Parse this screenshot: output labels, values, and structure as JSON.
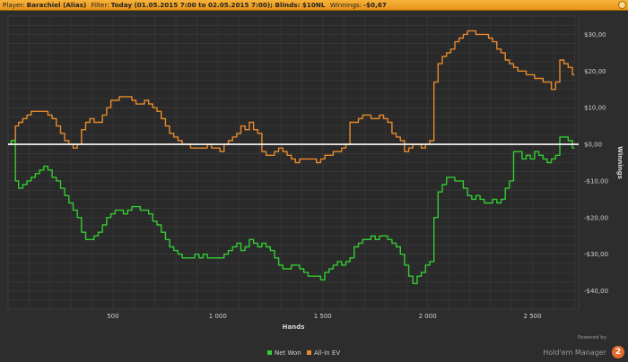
{
  "header": {
    "player_label": "Player:",
    "player_value": "Barachiel (Alias)",
    "filter_label": "Filter:",
    "filter_value": "Today (01.05.2015 7:00 to 02.05.2015 7:00); Blinds: $10NL",
    "winnings_label": "Winnings:",
    "winnings_value": "-$0,67"
  },
  "footer": {
    "powered_by": "Powered by",
    "product_name": "Hold'em Manager",
    "logo_text": "2"
  },
  "colors": {
    "background": "#2d2d2d",
    "plot_background": "#2a2a2a",
    "grid": "#3d3d3d",
    "net_won": "#33cc33",
    "all_in_ev": "#e88a2a",
    "zero_line": "#ffffff",
    "header": "#f0a52b"
  },
  "chart_data": {
    "type": "line",
    "xlabel": "Hands",
    "ylabel": "Winnings",
    "xlim": [
      0,
      2720
    ],
    "ylim": [
      -45,
      35
    ],
    "x_ticks": [
      500,
      1000,
      1500,
      2000,
      2500
    ],
    "x_tick_labels": [
      "500",
      "1 000",
      "1 500",
      "2 000",
      "2 500"
    ],
    "y_ticks": [
      30,
      20,
      10,
      0,
      -10,
      -20,
      -30,
      -40
    ],
    "y_tick_labels": [
      "$30,00",
      "$20,00",
      "$10,00",
      "$0,00",
      "-$10,00",
      "-$20,00",
      "-$30,00",
      "-$40,00"
    ],
    "grid": true,
    "legend_position": "bottom",
    "x": [
      0,
      30,
      40,
      60,
      80,
      100,
      120,
      140,
      160,
      180,
      200,
      220,
      240,
      260,
      280,
      300,
      320,
      340,
      360,
      380,
      400,
      420,
      440,
      460,
      480,
      500,
      520,
      540,
      560,
      580,
      600,
      620,
      640,
      660,
      680,
      700,
      720,
      740,
      760,
      780,
      800,
      820,
      840,
      860,
      880,
      900,
      920,
      940,
      960,
      980,
      1000,
      1020,
      1040,
      1060,
      1080,
      1100,
      1120,
      1140,
      1160,
      1180,
      1200,
      1220,
      1240,
      1260,
      1280,
      1300,
      1320,
      1340,
      1360,
      1380,
      1400,
      1420,
      1440,
      1460,
      1480,
      1500,
      1520,
      1540,
      1560,
      1580,
      1600,
      1620,
      1640,
      1660,
      1680,
      1700,
      1720,
      1740,
      1760,
      1780,
      1800,
      1820,
      1840,
      1860,
      1880,
      1900,
      1920,
      1940,
      1960,
      1980,
      2000,
      2020,
      2040,
      2060,
      2080,
      2100,
      2120,
      2140,
      2160,
      2180,
      2200,
      2220,
      2240,
      2260,
      2280,
      2300,
      2320,
      2340,
      2360,
      2380,
      2400,
      2420,
      2440,
      2460,
      2480,
      2500,
      2520,
      2540,
      2560,
      2580,
      2600,
      2620,
      2640,
      2660,
      2680,
      2700
    ],
    "series": [
      {
        "name": "Net Won",
        "color": "#33cc33",
        "values": [
          0,
          1,
          -10,
          -12,
          -11,
          -10,
          -9,
          -8,
          -7,
          -6,
          -7,
          -9,
          -10,
          -12,
          -14,
          -16,
          -18,
          -20,
          -24,
          -26,
          -26,
          -25,
          -24,
          -22,
          -20,
          -19,
          -18,
          -18,
          -19,
          -18,
          -17,
          -17,
          -18,
          -18,
          -19,
          -21,
          -22,
          -24,
          -26,
          -28,
          -29,
          -30,
          -31,
          -31,
          -31,
          -30,
          -31,
          -30,
          -31,
          -31,
          -31,
          -31,
          -30,
          -29,
          -28,
          -27,
          -29,
          -28,
          -26,
          -27,
          -28,
          -27,
          -28,
          -29,
          -31,
          -33,
          -34,
          -34,
          -33,
          -33,
          -34,
          -35,
          -36,
          -36,
          -36,
          -37,
          -35,
          -34,
          -33,
          -32,
          -33,
          -32,
          -31,
          -28,
          -27,
          -26,
          -26,
          -25,
          -26,
          -25,
          -25,
          -26,
          -27,
          -28,
          -30,
          -33,
          -36,
          -38,
          -36,
          -35,
          -33,
          -32,
          -20,
          -13,
          -11,
          -9,
          -9,
          -10,
          -10,
          -12,
          -14,
          -15,
          -14,
          -15,
          -16,
          -16,
          -15,
          -16,
          -15,
          -12,
          -10,
          -2,
          -2,
          -4,
          -3,
          -4,
          -2,
          -3,
          -4,
          -5,
          -4,
          -3,
          2,
          2,
          1,
          -1
        ]
      },
      {
        "name": "All-In EV",
        "color": "#e88a2a",
        "values": [
          0,
          1,
          5,
          6,
          7,
          8,
          9,
          9,
          9,
          9,
          8,
          7,
          5,
          3,
          1,
          0,
          -1,
          0,
          4,
          6,
          7,
          6,
          6,
          8,
          10,
          12,
          12,
          13,
          13,
          13,
          12,
          11,
          11,
          12,
          11,
          10,
          9,
          7,
          5,
          3,
          2,
          1,
          0,
          0,
          -1,
          -1,
          -1,
          -1,
          0,
          -1,
          -1,
          -2,
          0,
          1,
          2,
          3,
          5,
          4,
          6,
          4,
          3,
          -2,
          -3,
          -3,
          -2,
          -1,
          -2,
          -3,
          -4,
          -5,
          -4,
          -4,
          -4,
          -4,
          -5,
          -4,
          -3,
          -3,
          -2,
          -2,
          -1,
          0,
          6,
          6,
          7,
          8,
          8,
          7,
          7,
          8,
          7,
          6,
          3,
          2,
          1,
          -2,
          -1,
          0,
          0,
          -1,
          0,
          1,
          17,
          22,
          24,
          25,
          26,
          28,
          29,
          30,
          31,
          31,
          30,
          30,
          30,
          29,
          28,
          26,
          25,
          23,
          22,
          21,
          20,
          20,
          19,
          19,
          18,
          18,
          17,
          17,
          15,
          17,
          23,
          22,
          21,
          19
        ]
      }
    ]
  }
}
